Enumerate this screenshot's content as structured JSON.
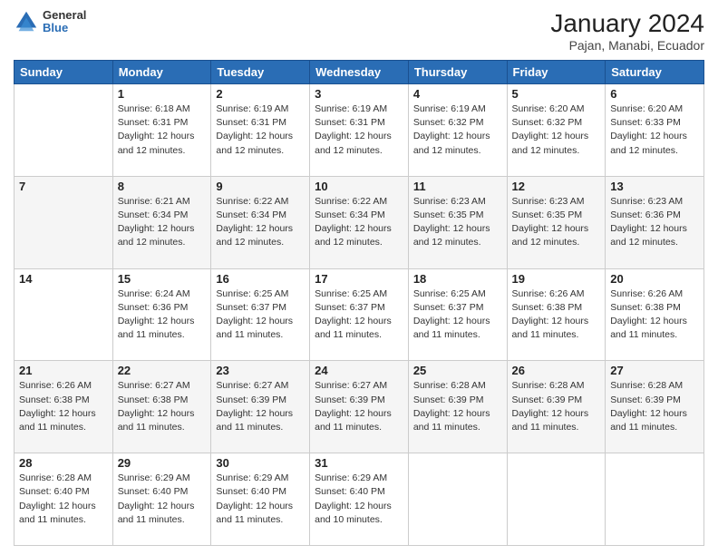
{
  "header": {
    "logo": {
      "general": "General",
      "blue": "Blue"
    },
    "title": "January 2024",
    "subtitle": "Pajan, Manabi, Ecuador"
  },
  "calendar": {
    "days_of_week": [
      "Sunday",
      "Monday",
      "Tuesday",
      "Wednesday",
      "Thursday",
      "Friday",
      "Saturday"
    ],
    "weeks": [
      [
        {
          "day": "",
          "info": ""
        },
        {
          "day": "1",
          "info": "Sunrise: 6:18 AM\nSunset: 6:31 PM\nDaylight: 12 hours\nand 12 minutes."
        },
        {
          "day": "2",
          "info": "Sunrise: 6:19 AM\nSunset: 6:31 PM\nDaylight: 12 hours\nand 12 minutes."
        },
        {
          "day": "3",
          "info": "Sunrise: 6:19 AM\nSunset: 6:31 PM\nDaylight: 12 hours\nand 12 minutes."
        },
        {
          "day": "4",
          "info": "Sunrise: 6:19 AM\nSunset: 6:32 PM\nDaylight: 12 hours\nand 12 minutes."
        },
        {
          "day": "5",
          "info": "Sunrise: 6:20 AM\nSunset: 6:32 PM\nDaylight: 12 hours\nand 12 minutes."
        },
        {
          "day": "6",
          "info": "Sunrise: 6:20 AM\nSunset: 6:33 PM\nDaylight: 12 hours\nand 12 minutes."
        }
      ],
      [
        {
          "day": "7",
          "info": ""
        },
        {
          "day": "8",
          "info": "Sunrise: 6:21 AM\nSunset: 6:34 PM\nDaylight: 12 hours\nand 12 minutes."
        },
        {
          "day": "9",
          "info": "Sunrise: 6:22 AM\nSunset: 6:34 PM\nDaylight: 12 hours\nand 12 minutes."
        },
        {
          "day": "10",
          "info": "Sunrise: 6:22 AM\nSunset: 6:34 PM\nDaylight: 12 hours\nand 12 minutes."
        },
        {
          "day": "11",
          "info": "Sunrise: 6:23 AM\nSunset: 6:35 PM\nDaylight: 12 hours\nand 12 minutes."
        },
        {
          "day": "12",
          "info": "Sunrise: 6:23 AM\nSunset: 6:35 PM\nDaylight: 12 hours\nand 12 minutes."
        },
        {
          "day": "13",
          "info": "Sunrise: 6:23 AM\nSunset: 6:36 PM\nDaylight: 12 hours\nand 12 minutes."
        }
      ],
      [
        {
          "day": "14",
          "info": ""
        },
        {
          "day": "15",
          "info": "Sunrise: 6:24 AM\nSunset: 6:36 PM\nDaylight: 12 hours\nand 11 minutes."
        },
        {
          "day": "16",
          "info": "Sunrise: 6:25 AM\nSunset: 6:37 PM\nDaylight: 12 hours\nand 11 minutes."
        },
        {
          "day": "17",
          "info": "Sunrise: 6:25 AM\nSunset: 6:37 PM\nDaylight: 12 hours\nand 11 minutes."
        },
        {
          "day": "18",
          "info": "Sunrise: 6:25 AM\nSunset: 6:37 PM\nDaylight: 12 hours\nand 11 minutes."
        },
        {
          "day": "19",
          "info": "Sunrise: 6:26 AM\nSunset: 6:38 PM\nDaylight: 12 hours\nand 11 minutes."
        },
        {
          "day": "20",
          "info": "Sunrise: 6:26 AM\nSunset: 6:38 PM\nDaylight: 12 hours\nand 11 minutes."
        }
      ],
      [
        {
          "day": "21",
          "info": "Sunrise: 6:26 AM\nSunset: 6:38 PM\nDaylight: 12 hours\nand 11 minutes."
        },
        {
          "day": "22",
          "info": "Sunrise: 6:27 AM\nSunset: 6:38 PM\nDaylight: 12 hours\nand 11 minutes."
        },
        {
          "day": "23",
          "info": "Sunrise: 6:27 AM\nSunset: 6:39 PM\nDaylight: 12 hours\nand 11 minutes."
        },
        {
          "day": "24",
          "info": "Sunrise: 6:27 AM\nSunset: 6:39 PM\nDaylight: 12 hours\nand 11 minutes."
        },
        {
          "day": "25",
          "info": "Sunrise: 6:28 AM\nSunset: 6:39 PM\nDaylight: 12 hours\nand 11 minutes."
        },
        {
          "day": "26",
          "info": "Sunrise: 6:28 AM\nSunset: 6:39 PM\nDaylight: 12 hours\nand 11 minutes."
        },
        {
          "day": "27",
          "info": "Sunrise: 6:28 AM\nSunset: 6:39 PM\nDaylight: 12 hours\nand 11 minutes."
        }
      ],
      [
        {
          "day": "28",
          "info": "Sunrise: 6:28 AM\nSunset: 6:40 PM\nDaylight: 12 hours\nand 11 minutes."
        },
        {
          "day": "29",
          "info": "Sunrise: 6:29 AM\nSunset: 6:40 PM\nDaylight: 12 hours\nand 11 minutes."
        },
        {
          "day": "30",
          "info": "Sunrise: 6:29 AM\nSunset: 6:40 PM\nDaylight: 12 hours\nand 11 minutes."
        },
        {
          "day": "31",
          "info": "Sunrise: 6:29 AM\nSunset: 6:40 PM\nDaylight: 12 hours\nand 10 minutes."
        },
        {
          "day": "",
          "info": ""
        },
        {
          "day": "",
          "info": ""
        },
        {
          "day": "",
          "info": ""
        }
      ]
    ]
  }
}
